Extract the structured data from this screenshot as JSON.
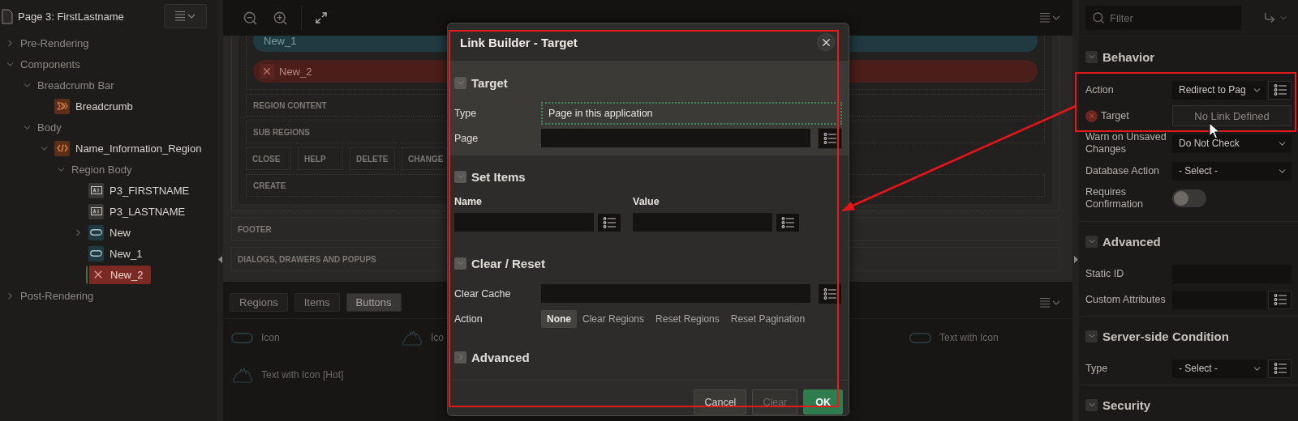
{
  "outline": {
    "title": "Page 3: FirstLastname",
    "tree": [
      {
        "label": "Pre-Rendering",
        "kind": "group",
        "expanded": false,
        "selected": false
      },
      {
        "label": "Components",
        "kind": "group",
        "expanded": true,
        "selected": false,
        "children": [
          {
            "label": "Breadcrumb Bar",
            "kind": "group",
            "expanded": true,
            "selected": false,
            "children": [
              {
                "label": "Breadcrumb",
                "kind": "breadcrumb",
                "selected": false
              }
            ]
          },
          {
            "label": "Body",
            "kind": "group",
            "expanded": true,
            "selected": false,
            "children": [
              {
                "label": "Name_Information_Region",
                "kind": "region",
                "expanded": true,
                "selected": false,
                "children": [
                  {
                    "label": "Region Body",
                    "kind": "group",
                    "expanded": true,
                    "selected": false,
                    "children": [
                      {
                        "label": "P3_FIRSTNAME",
                        "kind": "item",
                        "selected": false
                      },
                      {
                        "label": "P3_LASTNAME",
                        "kind": "item",
                        "selected": false
                      },
                      {
                        "label": "New",
                        "kind": "button",
                        "expanded": false,
                        "selected": false
                      },
                      {
                        "label": "New_1",
                        "kind": "button",
                        "selected": false
                      },
                      {
                        "label": "New_2",
                        "kind": "error",
                        "selected": true
                      }
                    ]
                  }
                ]
              }
            ]
          }
        ]
      },
      {
        "label": "Post-Rendering",
        "kind": "group",
        "expanded": false,
        "selected": false
      }
    ]
  },
  "canvas": {
    "region_buttons": [
      {
        "label": "New_1",
        "error": false
      },
      {
        "label": "New_2",
        "error": true
      }
    ],
    "slots": [
      {
        "kind": "row",
        "label": "REGION CONTENT"
      },
      {
        "kind": "row",
        "label": "SUB REGIONS"
      },
      {
        "kind": "cells",
        "cells": [
          "CLOSE",
          "HELP",
          "DELETE",
          "CHANGE"
        ]
      },
      {
        "kind": "row",
        "label": "CREATE"
      }
    ],
    "page_slots": [
      "FOOTER",
      "DIALOGS, DRAWERS AND POPUPS"
    ]
  },
  "gallery": {
    "tabs": [
      {
        "label": "Regions",
        "selected": false
      },
      {
        "label": "Items",
        "selected": false
      },
      {
        "label": "Buttons",
        "selected": true
      }
    ],
    "items": [
      {
        "label": "Icon",
        "kind": "pill"
      },
      {
        "label": "Ico",
        "kind": "flame"
      },
      {
        "label": "Text with Icon",
        "kind": "pill"
      },
      {
        "label": "Text with Icon [Hot]",
        "kind": "flame"
      }
    ]
  },
  "properties": {
    "filter": {
      "placeholder": "Filter"
    },
    "sections": [
      {
        "title": "Behavior",
        "expanded": true,
        "fields": [
          {
            "kind": "select",
            "label": "Action",
            "value": "Redirect to Pag",
            "list_button": true,
            "error": false
          },
          {
            "kind": "link",
            "label": "Target",
            "value": "No Link Defined",
            "list_button": false,
            "error": true
          },
          {
            "kind": "select",
            "label": "Warn on Unsaved Changes",
            "value": "Do Not Check",
            "list_button": false,
            "error": false
          },
          {
            "kind": "select",
            "label": "Database Action",
            "value": "- Select -",
            "list_button": false,
            "error": false
          },
          {
            "kind": "switch",
            "label": "Requires Confirmation",
            "on": false,
            "list_button": false,
            "error": false
          }
        ]
      },
      {
        "title": "Advanced",
        "expanded": true,
        "fields": [
          {
            "kind": "text",
            "label": "Static ID",
            "list_button": false,
            "error": false
          },
          {
            "kind": "text",
            "label": "Custom Attributes",
            "list_button": true,
            "error": false
          }
        ]
      },
      {
        "title": "Server-side Condition",
        "expanded": true,
        "fields": [
          {
            "kind": "select",
            "label": "Type",
            "value": "- Select -",
            "list_button": true,
            "error": false
          }
        ]
      },
      {
        "title": "Security",
        "expanded": true
      }
    ]
  },
  "dialog": {
    "title": "Link Builder - Target",
    "sections": [
      {
        "title": "Target",
        "expanded": true,
        "highlighted": true,
        "rows": [
          {
            "kind": "select",
            "label": "Type",
            "value": "Page in this application",
            "focused": true
          },
          {
            "kind": "text",
            "label": "Page"
          }
        ]
      },
      {
        "title": "Set Items",
        "expanded": true,
        "highlighted": false,
        "rows": [
          {
            "kind": "pair",
            "columns": [
              "Name",
              "Value"
            ]
          }
        ]
      },
      {
        "title": "Clear / Reset",
        "expanded": true,
        "highlighted": false,
        "rows": [
          {
            "kind": "text",
            "label": "Clear Cache"
          },
          {
            "kind": "radio",
            "label": "Action",
            "options": [
              {
                "label": "None",
                "selected": true
              },
              {
                "label": "Clear Regions",
                "selected": false
              },
              {
                "label": "Reset Regions",
                "selected": false
              },
              {
                "label": "Reset Pagination",
                "selected": false
              }
            ]
          }
        ]
      },
      {
        "title": "Advanced",
        "expanded": false,
        "highlighted": false
      }
    ],
    "buttons": [
      {
        "label": "Cancel",
        "kind": "default",
        "disabled": false
      },
      {
        "label": "Clear",
        "kind": "default",
        "disabled": true
      },
      {
        "label": "OK",
        "kind": "primary",
        "disabled": false
      }
    ]
  }
}
